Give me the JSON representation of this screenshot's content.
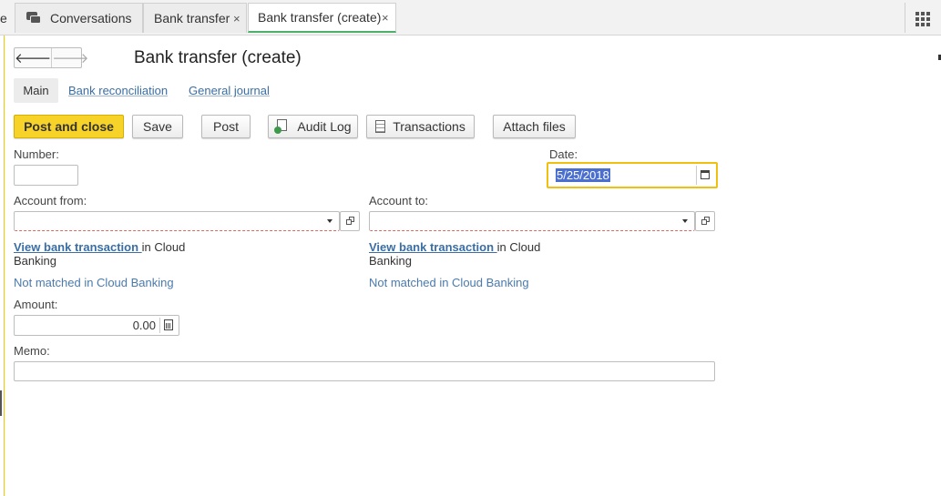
{
  "tabs": {
    "cut_label": "e",
    "conversations": "Conversations",
    "bank_transfer": "Bank transfer",
    "bank_transfer_create": "Bank transfer (create)",
    "close_glyph": "×"
  },
  "header": {
    "back_glyph": "🡐",
    "forward_glyph": "🡒",
    "title": "Bank transfer (create)"
  },
  "sections": {
    "main": "Main",
    "bank_reconciliation": "Bank reconciliation",
    "general_journal": "General journal"
  },
  "toolbar": {
    "post_and_close": "Post and close",
    "save": "Save",
    "post": "Post",
    "audit_log": "Audit Log",
    "transactions": "Transactions",
    "attach_files": "Attach files"
  },
  "form": {
    "number_label": "Number:",
    "number_value": "",
    "date_label": "Date:",
    "date_value": "5/25/2018",
    "account_from_label": "Account from:",
    "account_from_value": "",
    "account_to_label": "Account to:",
    "account_to_value": "",
    "view_bank_transaction": "View bank transaction ",
    "in_cloud": "in Cloud",
    "banking": "Banking",
    "not_matched": "Not matched in Cloud Banking",
    "amount_label": "Amount:",
    "amount_value": "0.00",
    "memo_label": "Memo:",
    "memo_value": ""
  },
  "colors": {
    "primary_button": "#f7d32a",
    "link": "#3a6ea5",
    "focus_border": "#f0c010",
    "active_tab_underline": "#4caf6a"
  }
}
